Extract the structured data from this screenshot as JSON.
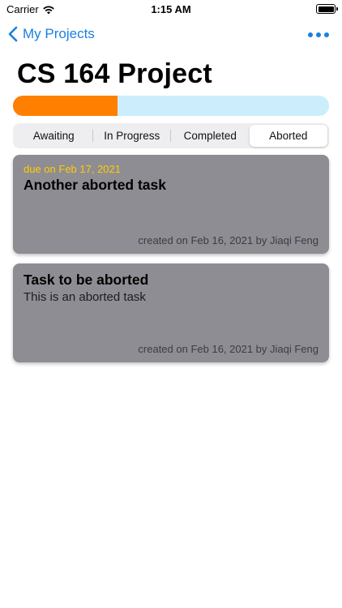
{
  "status_bar": {
    "carrier": "Carrier",
    "time": "1:15 AM"
  },
  "nav": {
    "back_label": "My Projects",
    "accent_color": "#1a7fe0"
  },
  "project": {
    "title": "CS 164 Project",
    "progress_fraction": 0.33
  },
  "segments": {
    "items": [
      "Awaiting",
      "In Progress",
      "Completed",
      "Aborted"
    ],
    "selected": "Aborted"
  },
  "tasks": [
    {
      "due": "due on Feb 17, 2021",
      "title": "Another aborted task",
      "description": "",
      "footer": "created on Feb 16, 2021 by Jiaqi Feng"
    },
    {
      "due": "",
      "title": "Task to be aborted",
      "description": "This is an aborted task",
      "footer": "created on Feb 16, 2021 by Jiaqi Feng"
    }
  ]
}
